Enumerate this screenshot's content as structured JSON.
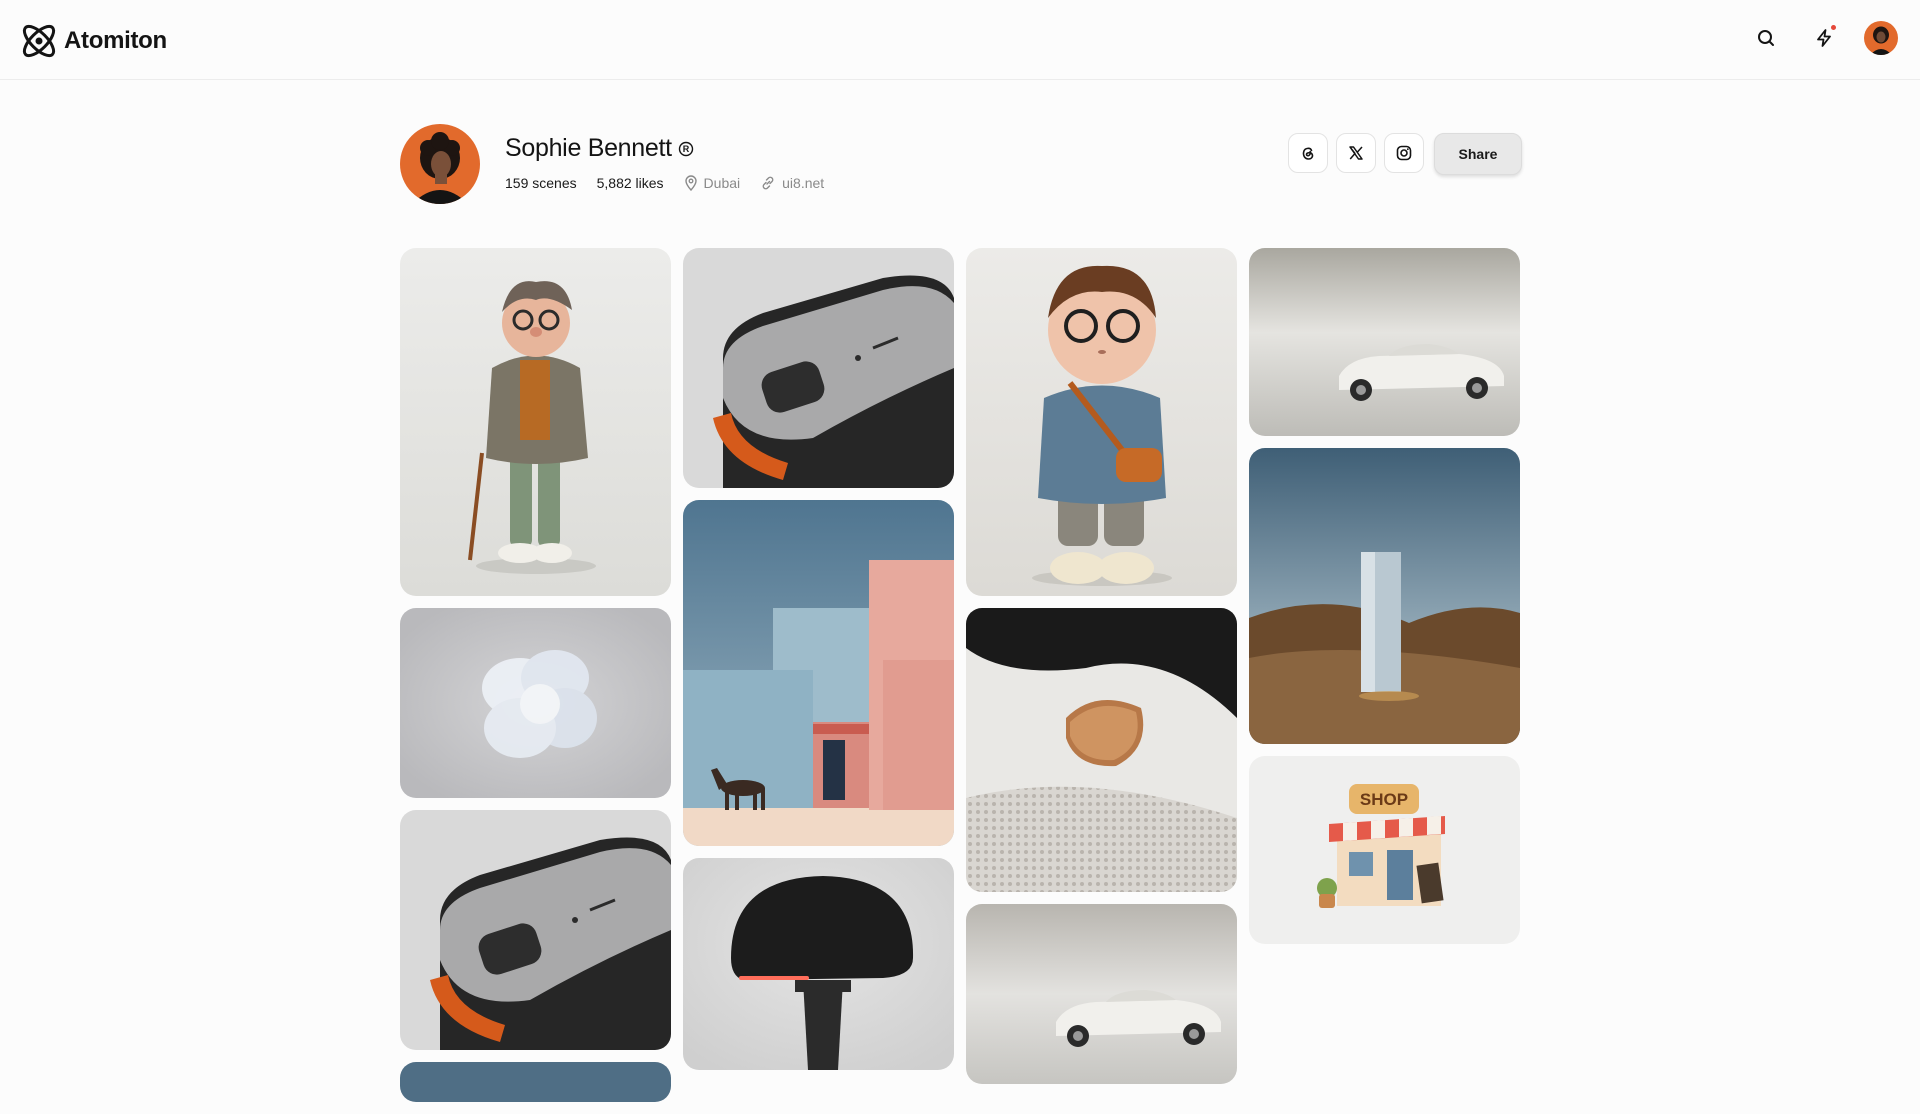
{
  "app": {
    "name": "Atomiton"
  },
  "topbar": {
    "search_icon": "search-icon",
    "activity_icon": "lightning-icon",
    "notification_color": "#e5483a"
  },
  "profile": {
    "name": "Sophie Bennett",
    "badge_icon": "registered-icon",
    "scenes": "159 scenes",
    "likes": "5,882 likes",
    "location": "Dubai",
    "website": "ui8.net",
    "socials": [
      "threads-icon",
      "x-icon",
      "instagram-icon"
    ],
    "share_label": "Share"
  },
  "colors": {
    "accent": "#e26a2c",
    "background": "#fcfcfc"
  },
  "gallery": {
    "columns": [
      [
        "old-man-character",
        "glass-flower",
        "metal-device",
        "sky-scene"
      ],
      [
        "metal-device",
        "pink-building-horse",
        "black-helmet-lamp"
      ],
      [
        "boy-character",
        "fabric-closeup",
        "white-car-studio"
      ],
      [
        "white-car-studio",
        "monolith-landscape",
        "shop-icon-3d"
      ]
    ]
  }
}
